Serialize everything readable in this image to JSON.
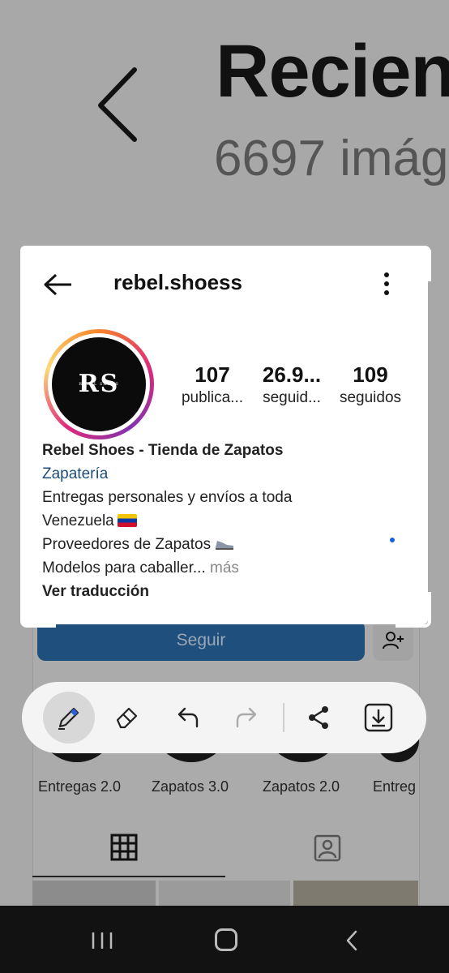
{
  "background": {
    "album_title": "Recien",
    "image_count": "6697 imág",
    "follow_button": "Seguir",
    "highlights": [
      "Entregas 2.0",
      "Zapatos 3.0",
      "Zapatos 2.0",
      "Entreg"
    ]
  },
  "profile": {
    "username": "rebel.shoess",
    "avatar_monogram": "RS",
    "avatar_subtext": "REBEL SHOES",
    "stats": [
      {
        "value": "107",
        "label": "publica..."
      },
      {
        "value": "26.9...",
        "label": "seguid..."
      },
      {
        "value": "109",
        "label": "seguidos"
      }
    ],
    "bio": {
      "name": "Rebel Shoes - Tienda de Zapatos",
      "category": "Zapatería",
      "line1": "Entregas personales y envíos a toda",
      "line2": "Venezuela",
      "line3": "Proveedores de Zapatos",
      "line4": "Modelos para caballer...",
      "more": "más",
      "translate": "Ver traducción"
    }
  },
  "toolbar": {
    "tools": [
      "pen-icon",
      "eraser-icon",
      "undo-icon",
      "redo-icon",
      "share-icon",
      "save-icon"
    ],
    "active_tool": "pen-icon"
  },
  "colors": {
    "accent": "#1f4f7d",
    "link": "#1c4d7c",
    "nav_bg": "#121212"
  }
}
